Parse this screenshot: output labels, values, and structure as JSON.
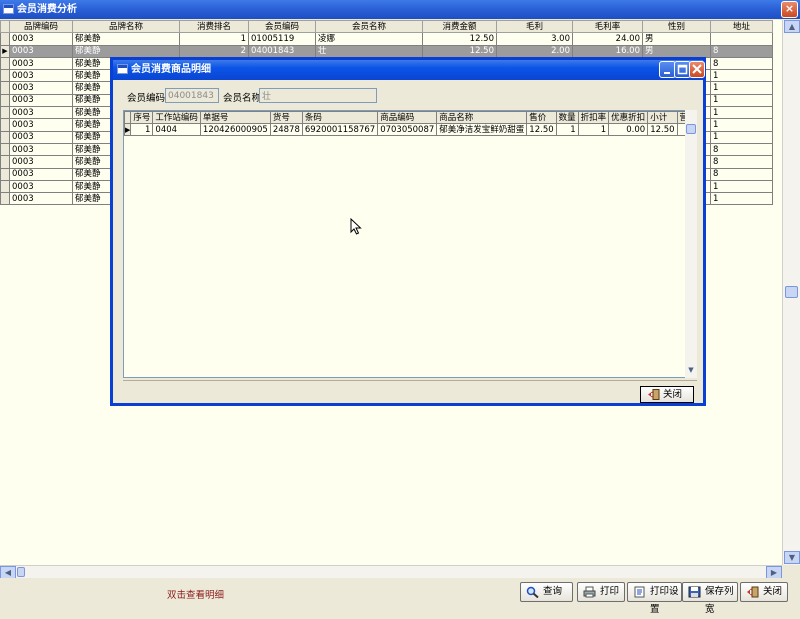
{
  "main": {
    "title": "会员消费分析",
    "close_glyph": "×",
    "columns": [
      "品牌编码",
      "品牌名称",
      "消费排名",
      "会员编码",
      "会员名称",
      "消费金额",
      "毛利",
      "毛利率",
      "性别",
      "地址"
    ],
    "rows": [
      [
        "0003",
        "郁美静",
        "1",
        "01005119",
        "凌娜",
        "12.50",
        "3.00",
        "24.00",
        "男",
        ""
      ],
      [
        "0003",
        "郁美静",
        "2",
        "04001843",
        "壮",
        "12.50",
        "2.00",
        "16.00",
        "男",
        "8"
      ],
      [
        "0003",
        "郁美静",
        "",
        "",
        "",
        "",
        "",
        "",
        "",
        "8"
      ],
      [
        "0003",
        "郁美静",
        "",
        "",
        "",
        "",
        "",
        "",
        "",
        "1"
      ],
      [
        "0003",
        "郁美静",
        "",
        "",
        "",
        "",
        "",
        "",
        "",
        "1"
      ],
      [
        "0003",
        "郁美静",
        "",
        "",
        "",
        "",
        "",
        "",
        "",
        "1"
      ],
      [
        "0003",
        "郁美静",
        "",
        "",
        "",
        "",
        "",
        "",
        "",
        "1"
      ],
      [
        "0003",
        "郁美静",
        "",
        "",
        "",
        "",
        "",
        "",
        "",
        "1"
      ],
      [
        "0003",
        "郁美静",
        "",
        "",
        "",
        "",
        "",
        "",
        "",
        "1"
      ],
      [
        "0003",
        "郁美静",
        "",
        "",
        "",
        "",
        "",
        "",
        "",
        "8"
      ],
      [
        "0003",
        "郁美静",
        "",
        "",
        "",
        "",
        "",
        "",
        "",
        "8"
      ],
      [
        "0003",
        "郁美静",
        "",
        "",
        "",
        "",
        "",
        "",
        "",
        "8"
      ],
      [
        "0003",
        "郁美静",
        "",
        "",
        "",
        "",
        "",
        "",
        "",
        "1"
      ],
      [
        "0003",
        "郁美静",
        "",
        "",
        "",
        "",
        "",
        "",
        "",
        "1"
      ]
    ]
  },
  "bottom": {
    "hint": "双击查看明细",
    "buttons": {
      "query": "查询",
      "print": "打印",
      "print_settings": "打印设置",
      "save_width": "保存列宽",
      "close": "关闭"
    }
  },
  "dialog": {
    "title": "会员消费商品明细",
    "member_code_label": "会员编码",
    "member_code_value": "04001843",
    "member_name_label": "会员名称",
    "member_name_value": "壮",
    "columns": [
      "序号",
      "工作站编码",
      "单据号",
      "货号",
      "条码",
      "商品编码",
      "商品名称",
      "售价",
      "数量",
      "折扣率",
      "优惠折扣",
      "小计",
      "营业员"
    ],
    "rows": [
      [
        "1",
        "0404",
        "120426000905",
        "24878",
        "6920001158767",
        "0703050087",
        "郁美净洁发宝鲜奶甜蛋",
        "12.50",
        "1",
        "1",
        "0.00",
        "12.50",
        ""
      ]
    ],
    "close_label": "关闭"
  },
  "colors": {
    "titlebar": "#2a5fd6",
    "grid_bg": "#FFFFF0",
    "selected_row": "#9c9c9c",
    "hint_text": "#8b1a1a"
  }
}
